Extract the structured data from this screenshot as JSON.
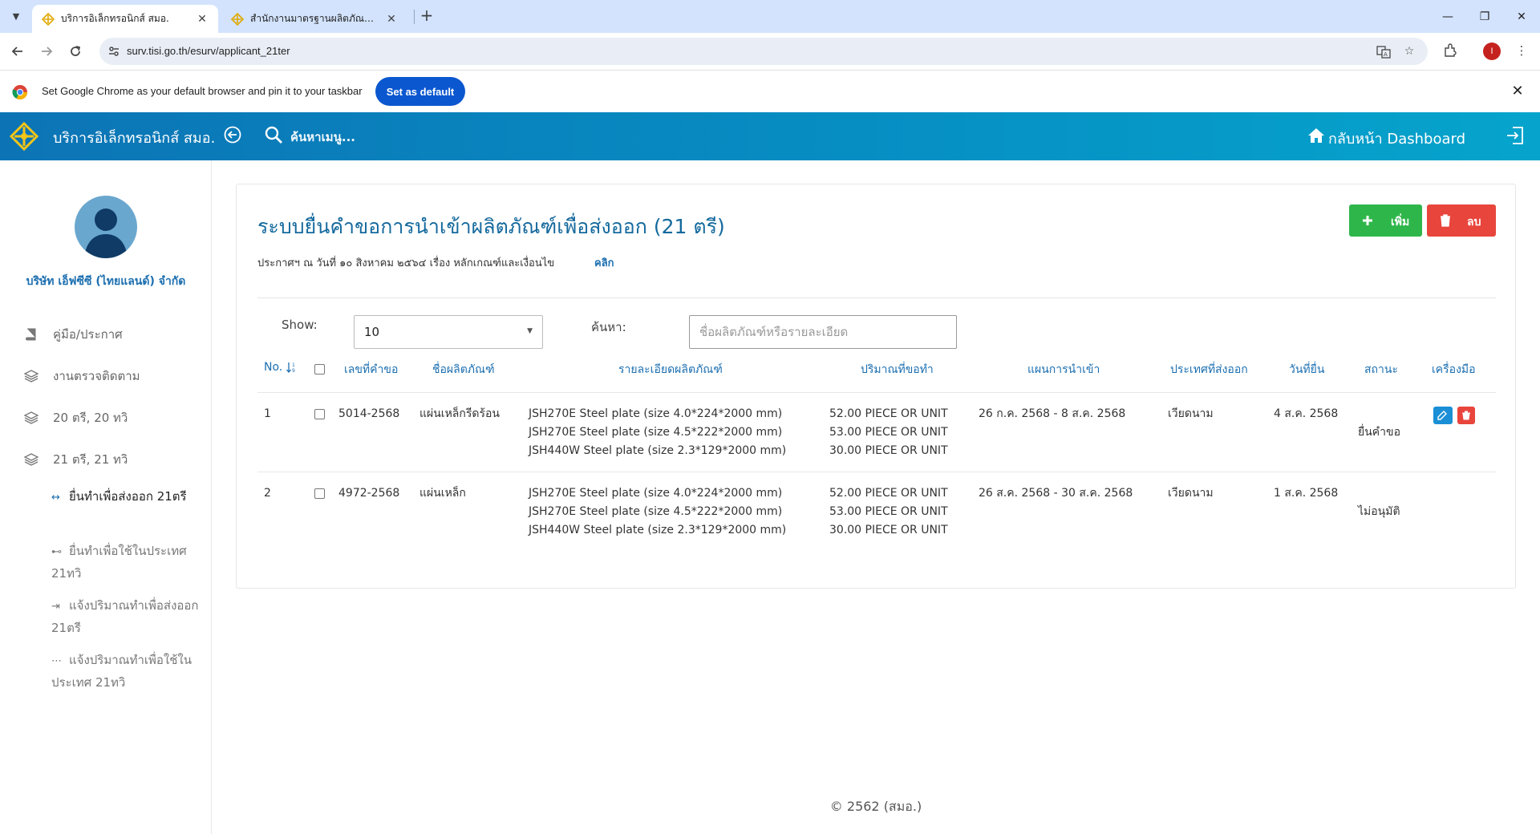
{
  "browser": {
    "tabs": [
      {
        "label": "บริการอิเล็กทรอนิกส์ สมอ.",
        "active": true
      },
      {
        "label": "สำนักงานมาตรฐานผลิตภัณฑ์อุตสาหกรรม",
        "active": false
      }
    ],
    "url": "surv.tisi.go.th/esurv/applicant_21ter",
    "infobar_text": "Set Google Chrome as your default browser and pin it to your taskbar",
    "infobar_button": "Set as default",
    "profile_initial": "I"
  },
  "app": {
    "title": "บริการอิเล็กทรอนิกส์ สมอ.",
    "search_label": "ค้นหาเมนู...",
    "dashboard_label": "กลับหน้า Dashboard",
    "accent": "#0c74b5"
  },
  "sidebar": {
    "company": "บริษัท เอ็ฟซีซี (ไทยแลนด์) จำกัด",
    "items": [
      {
        "label": "คู่มือ/ประกาศ",
        "icon": "book-icon"
      },
      {
        "label": "งานตรวจติดตาม",
        "icon": "layers-icon"
      },
      {
        "label": "20 ตรี, 20 ทวิ",
        "icon": "layers-icon"
      },
      {
        "label": "21 ตรี, 21 ทวิ",
        "icon": "layers-icon"
      }
    ],
    "subitems": [
      {
        "label": "ยื่นทำเพื่อส่งออก 21ตรี",
        "icon": "↔",
        "active": true
      },
      {
        "label": "ยื่นทำเพื่อใช้ในประเทศ 21ทวิ",
        "icon": "⊷",
        "active": false
      },
      {
        "label": "แจ้งปริมาณทำเพื่อส่งออก 21ตรี",
        "icon": "⇥",
        "active": false
      },
      {
        "label": "แจ้งปริมาณทำเพื่อใช้ในประเทศ 21ทวิ",
        "icon": "⋯",
        "active": false
      }
    ]
  },
  "main": {
    "title": "ระบบยื่นคำขอการนำเข้าผลิตภัณฑ์เพื่อส่งออก (21 ตรี)",
    "notice": "ประกาศฯ ณ วันที่ ๑๐ สิงหาคม ๒๕๖๔ เรื่อง หลักเกณฑ์และเงื่อนไข",
    "notice_link": "คลิก",
    "add_label": "เพิ่ม",
    "delete_label": "ลบ",
    "show_label": "Show:",
    "show_value": "10",
    "search_label": "ค้นหา:",
    "search_placeholder": "ชื่อผลิตภัณฑ์หรือรายละเอียด",
    "columns": {
      "no": "No.",
      "req_no": "เลขที่คำขอ",
      "product": "ชื่อผลิตภัณฑ์",
      "detail": "รายละเอียดผลิตภัณฑ์",
      "qty": "ปริมาณที่ขอทำ",
      "plan": "แผนการนำเข้า",
      "country": "ประเทศที่ส่งออก",
      "date": "วันที่ยื่น",
      "status": "สถานะ",
      "tools": "เครื่องมือ"
    },
    "rows": [
      {
        "no": "1",
        "req_no": "5014-2568",
        "product": "แผ่นเหล็กรีดร้อน",
        "details": [
          "JSH270E Steel plate (size 4.0*224*2000 mm)",
          "JSH270E Steel plate (size 4.5*222*2000 mm)",
          "JSH440W Steel plate (size 2.3*129*2000 mm)"
        ],
        "qtys": [
          "52.00 PIECE OR UNIT",
          "53.00 PIECE OR UNIT",
          "30.00 PIECE OR UNIT"
        ],
        "plan": "26 ก.ค. 2568 - 8 ส.ค. 2568",
        "country": "เวียดนาม",
        "date": "4 ส.ค. 2568",
        "status": "ยื่นคำขอ",
        "has_actions": true
      },
      {
        "no": "2",
        "req_no": "4972-2568",
        "product": "แผ่นเหล็ก",
        "details": [
          "JSH270E Steel plate (size 4.0*224*2000 mm)",
          "JSH270E Steel plate (size 4.5*222*2000 mm)",
          "JSH440W Steel plate (size 2.3*129*2000 mm)"
        ],
        "qtys": [
          "52.00 PIECE OR UNIT",
          "53.00 PIECE OR UNIT",
          "30.00 PIECE OR UNIT"
        ],
        "plan": "26 ส.ค. 2568 - 30 ส.ค. 2568",
        "country": "เวียดนาม",
        "date": "1 ส.ค. 2568",
        "status": "ไม่อนุมัติ",
        "has_actions": false
      }
    ]
  },
  "footer": "© 2562 (สมอ.)"
}
